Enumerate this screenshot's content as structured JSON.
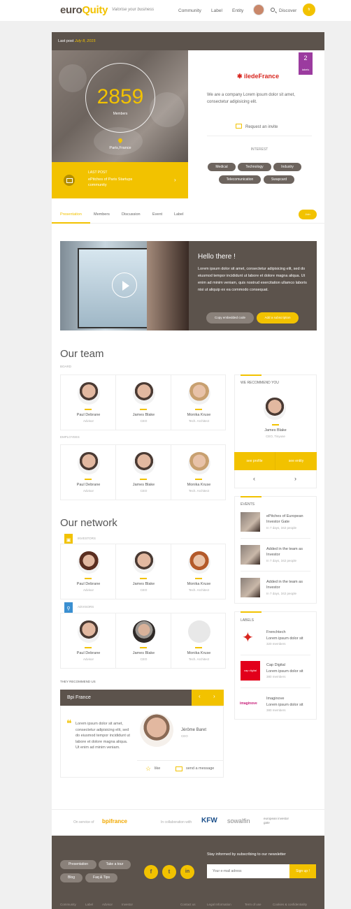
{
  "header": {
    "logo_a": "euro",
    "logo_b": "Quity",
    "tagline": "Valorise your business",
    "nav": [
      "Community",
      "Label",
      "Entity",
      "Discover"
    ],
    "lang": "fr"
  },
  "hero": {
    "last_post_label": "Last post",
    "last_post_date": "July 8, 2015",
    "members_count": "2859",
    "members_label": "Members",
    "location": "Paris,France",
    "lastpost_heading": "LAST POST",
    "lastpost_text": "ePitches of Paris Startups community",
    "labels_count": "2",
    "labels_word": "labels",
    "brand": "iledeFrance",
    "about": "We are a company Lorem ipsum dolor sit amet, consectetur adipisicing elit.",
    "invite": "Request an invite",
    "interest_title": "INTEREST",
    "interests": [
      "Medical",
      "Technology",
      "Industry",
      "Telecomunication",
      "Swapcard"
    ]
  },
  "tabs": [
    "Presentation",
    "Members",
    "Discussion",
    "Event",
    "Label"
  ],
  "join_label": "Join",
  "video": {
    "title": "Hello there !",
    "text": "Lorem ipsum dolor sit amet, consectetur adipisicing elit, sed do eiusmod tempor incididunt ut labore et dolore magna aliqua. Ut enim ad minim veniam, quis nostrud exercitation ullamco laboris nisi ut aliquip ex ea commodo consequat.",
    "copy_btn": "Copy embedded code",
    "subscribe_btn": "Add a subscription"
  },
  "team": {
    "title": "Our team",
    "board_label": "BOARD",
    "employees_label": "EMPLOYEES",
    "board": [
      {
        "name": "Paul Debrane",
        "role": "Advisor"
      },
      {
        "name": "James Blake",
        "role": "CEO"
      },
      {
        "name": "Monika Kruse",
        "role": "Tech. Architect"
      }
    ],
    "employees": [
      {
        "name": "Paul Debrane",
        "role": "Advisor"
      },
      {
        "name": "James Blake",
        "role": "CEO"
      },
      {
        "name": "Monika Kruse",
        "role": "Tech. Architect"
      }
    ]
  },
  "network": {
    "title": "Our network",
    "investors_label": "INVESTORS",
    "advisors_label": "ADVISORS",
    "investors": [
      {
        "name": "Paul Debrane",
        "role": "Advisor"
      },
      {
        "name": "James Blake",
        "role": "CEO"
      },
      {
        "name": "Monika Kruse",
        "role": "Tech. Architect"
      }
    ],
    "advisors": [
      {
        "name": "Paul Debrane",
        "role": "Advisor"
      },
      {
        "name": "James Blake",
        "role": "CEO"
      },
      {
        "name": "Monika Kruse",
        "role": "Tech. Architect"
      }
    ]
  },
  "recommend_us": {
    "title": "THEY RECOMMEND US",
    "company": "Bpi France",
    "quote": "Lorem ipsum dolor sit amet, consectetur adipisicing elit, sed do eiusmod tempor incididunt ut labore et dolore magna aliqua. Ut enim ad minim veniam.",
    "person": "Jérôme Baret",
    "role": "CEO",
    "like": "like",
    "message": "send a message"
  },
  "sidebar": {
    "recommend_title": "WE RECOMMEND YOU",
    "rec_name": "James Blake",
    "rec_role": "CEO, Tinyuse",
    "see_profile": "see profile",
    "see_entity": "see entity",
    "prev": "‹",
    "next": "›",
    "events_title": "EVENTS",
    "events": [
      {
        "title": "ePitches of European Investor Gate",
        "sub": "In 7 days, 342 people"
      },
      {
        "title": "Added in the team as Investor",
        "sub": "In 7 days, 342 people"
      },
      {
        "title": "Added in the team as Investor",
        "sub": "In 7 days, 342 people"
      }
    ],
    "labels_title": "LABELS",
    "labels": [
      {
        "name": "Frenchtech",
        "desc": "Lorem ipsum dolor sit",
        "members": "320 members"
      },
      {
        "name": "Cap Digital",
        "desc": "Lorem ipsum dolor sit",
        "members": "380 members"
      },
      {
        "name": "Imaginove",
        "desc": "Lorem ipsum dolor sit",
        "members": "380 members"
      }
    ],
    "capdigital_logo": "cap digital",
    "imaginove_logo": "imaginove"
  },
  "partners": {
    "service": "On service of",
    "bpi": "bpifrance",
    "collab": "In collaboration with",
    "kfw": "KFW",
    "sowalfin": "sowalfin",
    "eig": "european investor gate"
  },
  "footer": {
    "pills": [
      "Presentation",
      "Take a tour",
      "Blog",
      "Faq & Tips"
    ],
    "social": [
      "f",
      "t",
      "in"
    ],
    "nl_title": "Stay informed by subscribing to our newsletter",
    "nl_placeholder": "Your e-mail adress",
    "nl_btn": "Sign up !",
    "links_left": [
      "Community",
      "Label",
      "Advisor",
      "Investor"
    ],
    "links_right": [
      "Contact us",
      "Legal Information",
      "Term of use",
      "Cookies & confidentiality"
    ]
  },
  "colors": {
    "yellow": "#f2c200",
    "brown": "#5c534c",
    "purple": "#9b3b9f",
    "blue": "#3a8fd1"
  }
}
